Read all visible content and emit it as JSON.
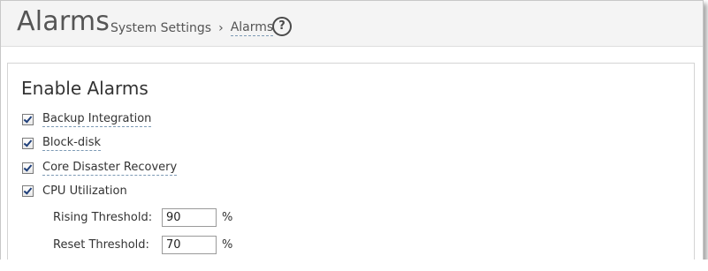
{
  "header": {
    "title": "Alarms",
    "breadcrumb": {
      "parent": "System Settings",
      "separator": "›",
      "current": "Alarms"
    },
    "help_icon": "?"
  },
  "section": {
    "title": "Enable Alarms",
    "checkboxes": [
      {
        "label": "Backup Integration",
        "checked": true
      },
      {
        "label": "Block-disk",
        "checked": true
      },
      {
        "label": "Core Disaster Recovery",
        "checked": true
      },
      {
        "label": "CPU Utilization",
        "checked": true
      }
    ],
    "cpu": {
      "rising_label": "Rising Threshold:",
      "rising_value": "90",
      "reset_label": "Reset Threshold:",
      "reset_value": "70",
      "unit": "%"
    }
  },
  "colors": {
    "header_bg": "#f4f4f4",
    "link_underline": "#7d9ab5",
    "text": "#333333"
  }
}
